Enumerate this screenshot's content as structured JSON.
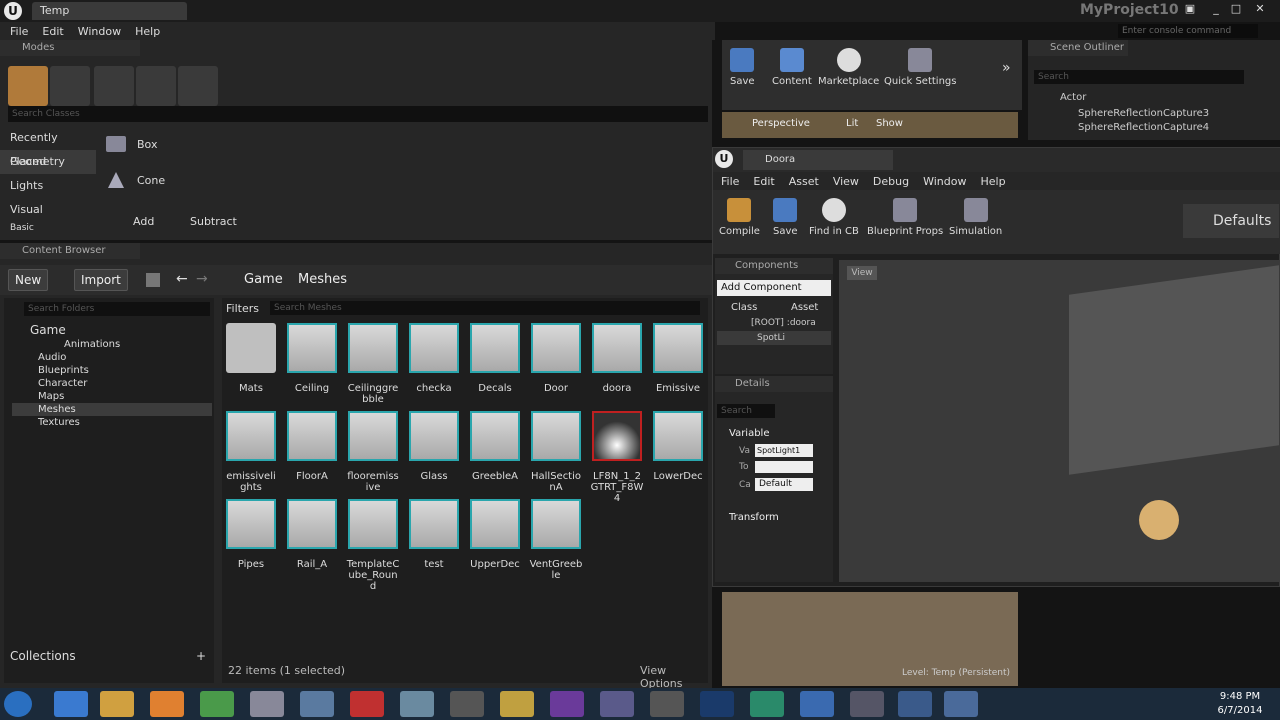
{
  "window": {
    "tab": "Temp",
    "project": "MyProject10",
    "console_placeholder": "Enter console command"
  },
  "menu": [
    "File",
    "Edit",
    "Window",
    "Help"
  ],
  "modes": {
    "title": "Modes",
    "search_placeholder": "Search Classes",
    "categories": [
      "Recently Placed",
      "Geometry",
      "Lights",
      "Visual",
      "Basic"
    ],
    "items": [
      "Box",
      "Cone"
    ],
    "add": "Add",
    "subtract": "Subtract"
  },
  "content_browser": {
    "title": "Content Browser",
    "new": "New",
    "import": "Import",
    "path": [
      "Game",
      "Meshes"
    ],
    "folder_search": "Search Folders",
    "filters": "Filters",
    "asset_search": "Search Meshes",
    "tree": [
      "Game",
      "Animations",
      "Audio",
      "Blueprints",
      "Character",
      "Maps",
      "Meshes",
      "Textures"
    ],
    "collections": "Collections",
    "status": "22 items (1 selected)",
    "view_options": "View Options",
    "assets": [
      "Mats",
      "Ceiling",
      "Ceilinggrebble",
      "checka",
      "Decals",
      "Door",
      "doora",
      "Emissive",
      "emissivelights",
      "FloorA",
      "flooremissive",
      "Glass",
      "GreebleA",
      "HallSectionA",
      "LF8N_1_2GTRT_F8W4",
      "LowerDec",
      "Pipes",
      "Rail_A",
      "TemplateCube_Round",
      "test",
      "UpperDec",
      "VentGreeble"
    ]
  },
  "main_toolbar": [
    "Save",
    "Content",
    "Marketplace",
    "Quick Settings"
  ],
  "viewport_bar": {
    "perspective": "Perspective",
    "lit": "Lit",
    "show": "Show"
  },
  "scene_outliner": {
    "title": "Scene Outliner",
    "search": "Search",
    "column": "Actor",
    "rows": [
      "SphereReflectionCapture3",
      "SphereReflectionCapture4"
    ]
  },
  "blueprint": {
    "tab": "Doora",
    "menu": [
      "File",
      "Edit",
      "Asset",
      "View",
      "Debug",
      "Window",
      "Help"
    ],
    "toolbar": [
      "Compile",
      "Save",
      "Find in CB",
      "Blueprint Props",
      "Simulation"
    ],
    "defaults": "Defaults",
    "components": {
      "title": "Components",
      "add": "Add Component",
      "class": "Class",
      "asset": "Asset",
      "root": "[ROOT] :doora",
      "child": "SpotLi"
    },
    "details": {
      "title": "Details",
      "search": "Search",
      "variable": "Variable",
      "var_label": "Va",
      "var_value": "SpotLight1",
      "tool_label": "To",
      "cat_label": "Ca",
      "cat_value": "Default",
      "transform": "Transform"
    },
    "view": "View"
  },
  "lower_viewport": {
    "level": "Level: Temp (Persistent)"
  },
  "taskbar": {
    "time": "9:48 PM",
    "date": "6/7/2014"
  }
}
